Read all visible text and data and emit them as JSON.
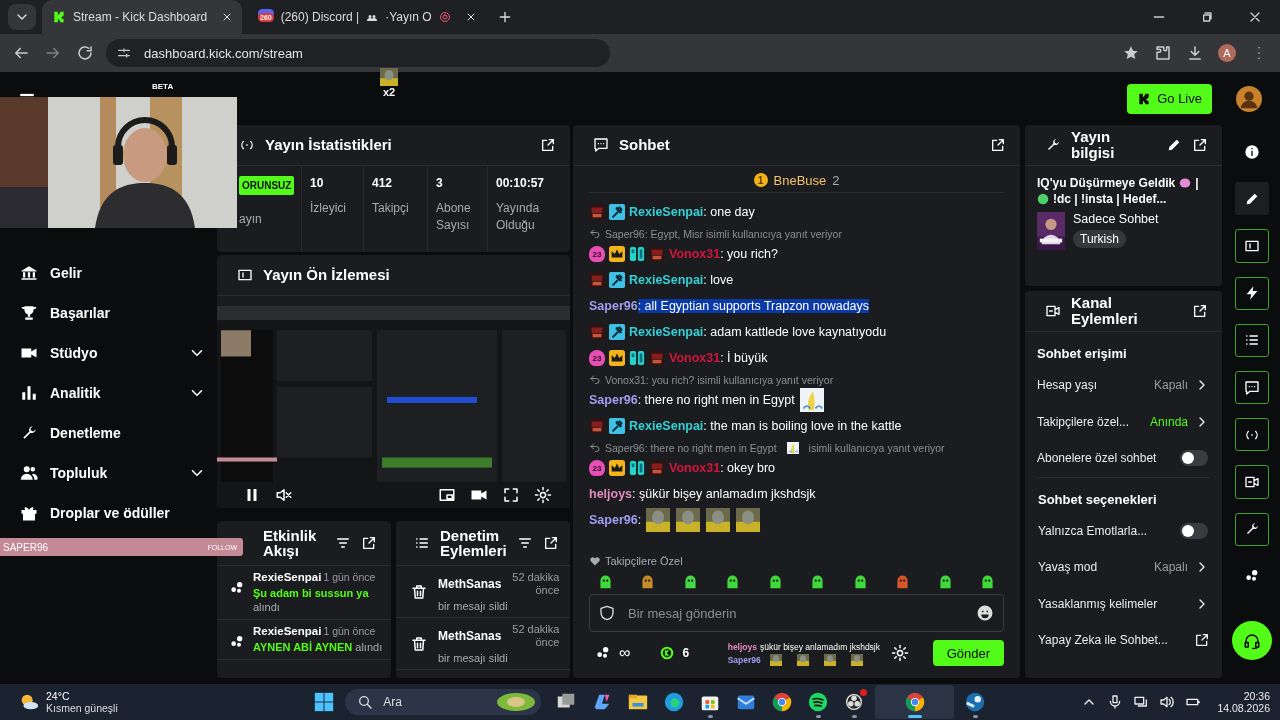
{
  "browser": {
    "tabs": [
      {
        "title": "Stream - Kick Dashboard",
        "selected": true
      },
      {
        "title": "(260) Discord |",
        "title_end": "·Yayın O",
        "badge": "260",
        "selected": false
      }
    ],
    "address": "dashboard.kick.com/stream",
    "overlay_emote": {
      "count": "x2"
    },
    "profile_initial": "A"
  },
  "header": {
    "logo_badge": "BETA",
    "go_live": "Go Live"
  },
  "follow_alert": {
    "name": "SAPER96",
    "label": "FOLLOW"
  },
  "nav": [
    {
      "label": "Gelir",
      "expandable": false
    },
    {
      "label": "Başarılar",
      "expandable": false
    },
    {
      "label": "Stüdyo",
      "expandable": true
    },
    {
      "label": "Analitik",
      "expandable": true
    },
    {
      "label": "Denetleme",
      "expandable": false
    },
    {
      "label": "Topluluk",
      "expandable": true
    },
    {
      "label": "Droplar ve ödüller",
      "expandable": false
    }
  ],
  "stats": {
    "title": "Yayın İstatistikleri",
    "cells": [
      {
        "badge": "ORUNSUZ",
        "label": "ayın"
      },
      {
        "value": "10",
        "label": "İzleyici"
      },
      {
        "value": "412",
        "label": "Takipçi"
      },
      {
        "value": "3",
        "label": "Abone Sayısı"
      },
      {
        "value": "00:10:57",
        "label": "Yayında Olduğu"
      }
    ]
  },
  "preview": {
    "title": "Yayın Ön İzlemesi"
  },
  "activity": {
    "title": "Etkinlik Akışı",
    "items": [
      {
        "user": "RexieSenpai",
        "time": "1 gün önce",
        "reward": "Şu adam bi sussun ya",
        "action": "alındı"
      },
      {
        "user": "RexieSenpai",
        "time": "1 gün önce",
        "reward": "AYNEN ABİ AYNEN",
        "action": "alındı"
      }
    ]
  },
  "moderation": {
    "title": "Denetim Eylemleri",
    "items": [
      {
        "user": "MethSanas",
        "time": "52 dakika önce",
        "action": "bir mesajı sildi"
      },
      {
        "user": "MethSanas",
        "time": "52 dakika önce",
        "action": "bir mesajı sildi"
      }
    ]
  },
  "chat": {
    "title": "Sohbet",
    "pinned": {
      "rank": "1",
      "name": "BneBuse",
      "count": "2"
    },
    "messages": [
      {
        "kind": "message",
        "user": "RexieSenpai",
        "color": "#35d0d6",
        "badges": [
          {
            "kind": "sub"
          },
          {
            "kind": "mod"
          }
        ],
        "text": ": one day",
        "highlighted": false
      },
      {
        "kind": "reply",
        "text": "Saper96: Egypt, Misr isimli kullanıcıya yanıt veriyor"
      },
      {
        "kind": "message",
        "user": "Vonox31",
        "color": "#d3163e",
        "badges": [
          {
            "kind": "level",
            "text": "23"
          },
          {
            "kind": "vip"
          },
          {
            "kind": "og"
          },
          {
            "kind": "sub"
          }
        ],
        "text": ": you rich?",
        "highlighted": false
      },
      {
        "kind": "message",
        "user": "RexieSenpai",
        "color": "#35d0d6",
        "badges": [
          {
            "kind": "sub"
          },
          {
            "kind": "mod"
          }
        ],
        "text": ": love",
        "highlighted": false
      },
      {
        "kind": "message",
        "user": "Saper96",
        "color": "#9f9ef2",
        "text": ": all Egyptian supports Trapzon nowadays",
        "highlighted": true
      },
      {
        "kind": "message",
        "user": "RexieSenpai",
        "color": "#35d0d6",
        "badges": [
          {
            "kind": "sub"
          },
          {
            "kind": "mod"
          }
        ],
        "text": ": adam kattlede love kaynatıyodu",
        "highlighted": false
      },
      {
        "kind": "message",
        "user": "Vonox31",
        "color": "#d3163e",
        "badges": [
          {
            "kind": "level",
            "text": "23"
          },
          {
            "kind": "vip"
          },
          {
            "kind": "og"
          },
          {
            "kind": "sub"
          }
        ],
        "text": ": İ büyük",
        "highlighted": false
      },
      {
        "kind": "reply",
        "text": "Vonox31: you rich? isimli kullanıcıya yanıt veriyor"
      },
      {
        "kind": "message",
        "user": "Saper96",
        "color": "#9f9ef2",
        "text": ": there no right men in Egypt",
        "emotes": [
          {
            "kind": "banana"
          }
        ],
        "highlighted": false
      },
      {
        "kind": "message",
        "user": "RexieSenpai",
        "color": "#35d0d6",
        "badges": [
          {
            "kind": "sub"
          },
          {
            "kind": "mod"
          }
        ],
        "text": ": the man is boiling love in the kattle",
        "highlighted": false
      },
      {
        "kind": "reply",
        "text": "Saper96: there no right men in Egypt",
        "emotes": [
          {
            "kind": "banana"
          }
        ],
        "after": "isimli kullanıcıya yanıt veriyor"
      },
      {
        "kind": "message",
        "user": "Vonox31",
        "color": "#d3163e",
        "badges": [
          {
            "kind": "level",
            "text": "23"
          },
          {
            "kind": "vip"
          },
          {
            "kind": "og"
          },
          {
            "kind": "sub"
          }
        ],
        "text": ": okey bro",
        "highlighted": false
      },
      {
        "kind": "message",
        "user": "heljoys",
        "color": "#e68bbd",
        "text": ": şükür bişey anlamadım jkshdsjk",
        "highlighted": false
      },
      {
        "kind": "message",
        "user": "Saper96",
        "color": "#9f9ef2",
        "text": ":",
        "highlighted": false
      }
    ],
    "followers_label": "Takipçilere Özel",
    "input": {
      "placeholder": "Bir mesaj gönderin"
    },
    "points": "∞",
    "kicks": "6",
    "send": "Gönder",
    "overlay": [
      {
        "user": "heljoys",
        "color": "#e68bbd",
        "text": "şükür bişey anlamadım jkshdsjk"
      },
      {
        "user": "Saper96",
        "color": "#9f9ef2"
      }
    ]
  },
  "stream_info": {
    "title": "Yayın bilgisi",
    "title_line1": "IQ'yu Düşürmeye Geldik",
    "title_sep": "|",
    "title_line2": "!dc | !insta | Hedef...",
    "category": "Sadece Sohbet",
    "language": "Turkish"
  },
  "channel_actions": {
    "title": "Kanal Eylemleri",
    "sections": [
      {
        "heading": "Sohbet erişimi",
        "rows": [
          {
            "kind": "select",
            "label": "Hesap yaşı",
            "value": "Kapalı",
            "active": false
          },
          {
            "kind": "select",
            "label": "Takipçilere özel...",
            "value": "Anında",
            "active": true
          },
          {
            "kind": "toggle",
            "label": "Abonelere özel sohbet",
            "on": false
          }
        ]
      },
      {
        "heading": "Sohbet seçenekleri",
        "rows": [
          {
            "kind": "toggle",
            "label": "Yalnızca Emotlarla...",
            "on": false
          },
          {
            "kind": "select",
            "label": "Yavaş mod",
            "value": "Kapalı",
            "active": false
          },
          {
            "kind": "link",
            "label": "Yasaklanmış kelimeler"
          },
          {
            "kind": "external",
            "label": "Yapay Zeka ile Sohbet..."
          }
        ]
      }
    ]
  },
  "rail": [
    {
      "kind": "info",
      "selected": false,
      "pinned": false
    },
    {
      "kind": "edit",
      "selected": true,
      "pinned": false
    },
    {
      "kind": "preview",
      "selected": false,
      "pinned": true
    },
    {
      "kind": "bolt",
      "selected": false,
      "pinned": true
    },
    {
      "kind": "list",
      "selected": false,
      "pinned": true
    },
    {
      "kind": "chat",
      "selected": false,
      "pinned": true
    },
    {
      "kind": "broadcast",
      "selected": false,
      "pinned": true
    },
    {
      "kind": "camera",
      "selected": false,
      "pinned": true
    },
    {
      "kind": "wrench",
      "selected": false,
      "pinned": true
    },
    {
      "kind": "dots",
      "selected": false,
      "pinned": false
    }
  ],
  "taskbar": {
    "weather": {
      "temp": "24°C",
      "desc": "Kısmen güneşli"
    },
    "search": {
      "placeholder": "Ara"
    },
    "apps": [
      {
        "kind": "start",
        "running": false,
        "active": false,
        "badge": false
      },
      {
        "kind": "taskview",
        "running": false,
        "active": false,
        "badge": false
      },
      {
        "kind": "copilot",
        "running": false,
        "active": false,
        "badge": false
      },
      {
        "kind": "files",
        "running": false,
        "active": false,
        "badge": false
      },
      {
        "kind": "edge",
        "running": false,
        "active": false,
        "badge": false
      },
      {
        "kind": "store",
        "running": true,
        "active": false,
        "badge": false
      },
      {
        "kind": "mail",
        "running": false,
        "active": false,
        "badge": false
      },
      {
        "kind": "chrome",
        "running": false,
        "active": false,
        "badge": false
      },
      {
        "kind": "music",
        "running": true,
        "active": false,
        "badge": false
      },
      {
        "kind": "recorder",
        "running": true,
        "active": false,
        "badge": true
      },
      {
        "kind": "chrome",
        "running": true,
        "active": true,
        "badge": false
      },
      {
        "kind": "game",
        "running": true,
        "active": false,
        "badge": false
      }
    ],
    "clock": {
      "time": "20:36",
      "date": "14.08.2026"
    }
  }
}
